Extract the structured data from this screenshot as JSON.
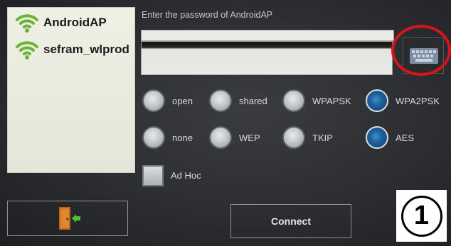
{
  "networks": [
    {
      "ssid": "AndroidAP",
      "icon": "wifi-icon"
    },
    {
      "ssid": "sefram_wlprod",
      "icon": "wifi-icon"
    }
  ],
  "password": {
    "prompt": "Enter the password of AndroidAP",
    "value": ""
  },
  "keyboard_button": {
    "icon": "keyboard-icon"
  },
  "auth_options": [
    {
      "label": "open",
      "selected": false
    },
    {
      "label": "shared",
      "selected": false
    },
    {
      "label": "WPAPSK",
      "selected": false
    },
    {
      "label": "WPA2PSK",
      "selected": true
    }
  ],
  "enc_options": [
    {
      "label": "none",
      "selected": false
    },
    {
      "label": "WEP",
      "selected": false
    },
    {
      "label": "TKIP",
      "selected": false
    },
    {
      "label": "AES",
      "selected": true
    }
  ],
  "adhoc": {
    "label": "Ad Hoc",
    "checked": false
  },
  "back_button": {
    "icon": "exit-door-icon"
  },
  "connect_button": {
    "label": "Connect"
  },
  "step_badge": {
    "number": "1"
  },
  "colors": {
    "wifi": "#6bb43a",
    "selected_radio": "#1f5f9c",
    "highlight": "#d8141b"
  }
}
